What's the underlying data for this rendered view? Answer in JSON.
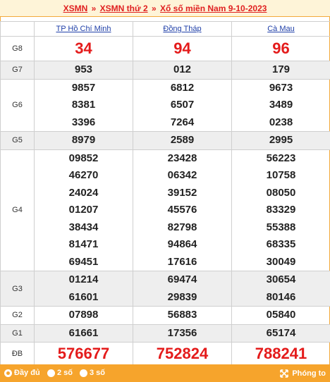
{
  "header": {
    "link1": "XSMN",
    "sep1": "»",
    "link2": "XSMN thứ 2",
    "sep2": "»",
    "link3": "Xổ số miền Nam 9-10-2023"
  },
  "provinces": [
    "TP Hồ Chí Minh",
    "Đồng Tháp",
    "Cà Mau"
  ],
  "rows": [
    {
      "label": "G8",
      "numbers": [
        [
          "34"
        ],
        [
          "94"
        ],
        [
          "96"
        ]
      ]
    },
    {
      "label": "G7",
      "numbers": [
        [
          "953"
        ],
        [
          "012"
        ],
        [
          "179"
        ]
      ]
    },
    {
      "label": "G6",
      "numbers": [
        [
          "9857",
          "8381",
          "3396"
        ],
        [
          "6812",
          "6507",
          "7264"
        ],
        [
          "9673",
          "3489",
          "0238"
        ]
      ]
    },
    {
      "label": "G5",
      "numbers": [
        [
          "8979"
        ],
        [
          "2589"
        ],
        [
          "2995"
        ]
      ]
    },
    {
      "label": "G4",
      "numbers": [
        [
          "09852",
          "46270",
          "24024",
          "01207",
          "38434",
          "81471",
          "69451"
        ],
        [
          "23428",
          "06342",
          "39152",
          "45576",
          "82798",
          "94864",
          "17616"
        ],
        [
          "56223",
          "10758",
          "08050",
          "83329",
          "55388",
          "68335",
          "30049"
        ]
      ]
    },
    {
      "label": "G3",
      "numbers": [
        [
          "01214",
          "61601"
        ],
        [
          "69474",
          "29839"
        ],
        [
          "30654",
          "80146"
        ]
      ]
    },
    {
      "label": "G2",
      "numbers": [
        [
          "07898"
        ],
        [
          "56883"
        ],
        [
          "05840"
        ]
      ]
    },
    {
      "label": "G1",
      "numbers": [
        [
          "61661"
        ],
        [
          "17356"
        ],
        [
          "65174"
        ]
      ]
    },
    {
      "label": "ĐB",
      "numbers": [
        [
          "576677"
        ],
        [
          "752824"
        ],
        [
          "788241"
        ]
      ]
    }
  ],
  "footer": {
    "options": [
      {
        "label": "Đầy đủ",
        "selected": true
      },
      {
        "label": "2 số",
        "selected": false
      },
      {
        "label": "3 số",
        "selected": false
      }
    ],
    "zoom_label": "Phóng to"
  },
  "colors": {
    "accent": "#f6a42c",
    "prize_red": "#e41b1b",
    "link_blue": "#1f3fa8"
  }
}
